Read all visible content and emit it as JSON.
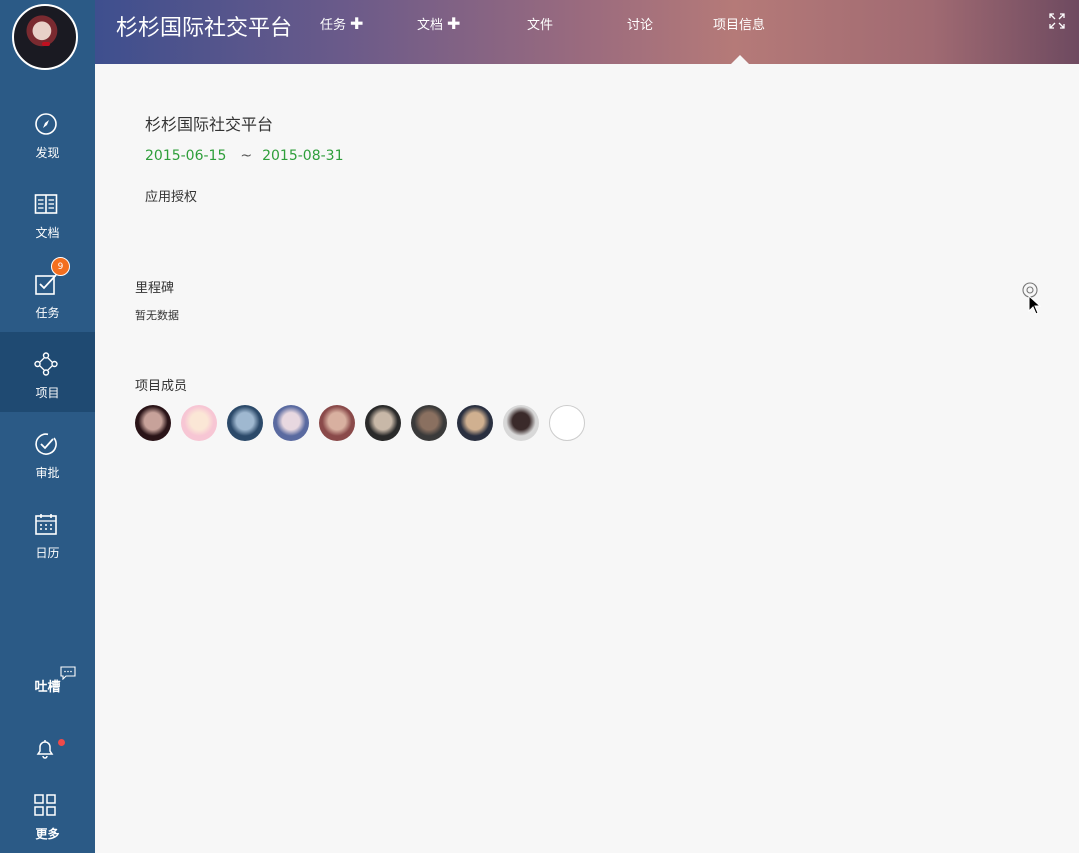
{
  "sidebar": {
    "items": [
      {
        "label": "发现",
        "icon": "compass-icon"
      },
      {
        "label": "文档",
        "icon": "book-icon"
      },
      {
        "label": "任务",
        "icon": "checkbox-icon",
        "badge": "9"
      },
      {
        "label": "项目",
        "icon": "project-nodes-icon",
        "active": true
      },
      {
        "label": "审批",
        "icon": "approval-check-icon"
      },
      {
        "label": "日历",
        "icon": "calendar-icon"
      }
    ],
    "tucao_label": "吐槽",
    "more_label": "更多",
    "notification_dot": true
  },
  "header": {
    "title": "杉杉国际社交平台",
    "tabs": [
      {
        "label": "任务",
        "has_plus": true
      },
      {
        "label": "文档",
        "has_plus": true
      },
      {
        "label": "文件",
        "has_plus": false
      },
      {
        "label": "讨论",
        "has_plus": false
      },
      {
        "label": "项目信息",
        "has_plus": false,
        "active": true
      }
    ]
  },
  "project": {
    "name": "杉杉国际社交平台",
    "start_date": "2015-06-15",
    "separator": "~",
    "end_date": "2015-08-31",
    "app_auth": "应用授权"
  },
  "milestones": {
    "label": "里程碑",
    "empty_text": "暂无数据"
  },
  "members": {
    "label": "项目成员",
    "avatars": [
      {
        "colors": [
          "#2a1418",
          "#c7a29a"
        ]
      },
      {
        "colors": [
          "#f7c6d4",
          "#fbe7d6"
        ]
      },
      {
        "colors": [
          "#2c4a6a",
          "#9fb8d0"
        ]
      },
      {
        "colors": [
          "#5a6aa0",
          "#e8d8e0"
        ]
      },
      {
        "colors": [
          "#8a4a4a",
          "#d8b0a0"
        ]
      },
      {
        "colors": [
          "#2a2a2a",
          "#c8b8a8"
        ]
      },
      {
        "colors": [
          "#3a3a3a",
          "#8a7060"
        ]
      },
      {
        "colors": [
          "#2a3040",
          "#d0b090"
        ]
      },
      {
        "colors": [
          "#d8d8d8",
          "#3a2a2a"
        ]
      }
    ]
  },
  "colors": {
    "sidebar": "#2b5a86",
    "sidebar_active": "#1f4a72",
    "badge": "#f36f1f",
    "date_green": "#2e9e3a",
    "notify_dot": "#ef4a4a"
  }
}
